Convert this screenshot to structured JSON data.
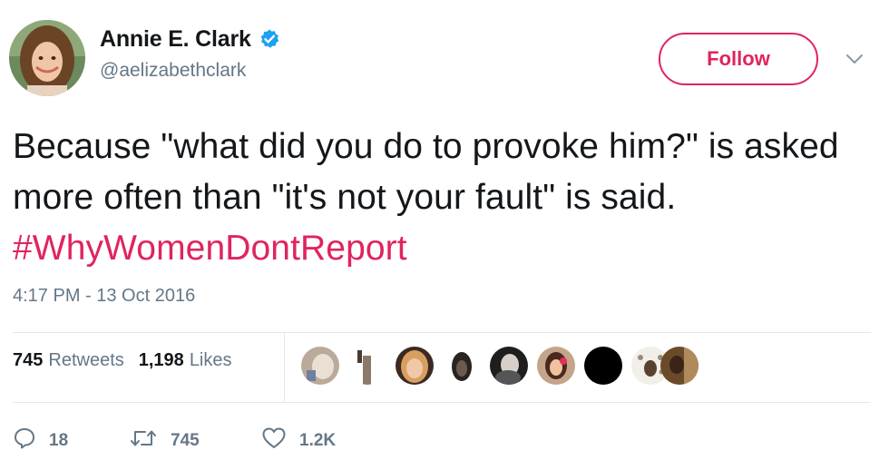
{
  "user": {
    "display_name": "Annie E. Clark",
    "handle": "@aelizabethclark",
    "avatar_icon": "profile-photo",
    "verified_icon": "verified-badge-icon"
  },
  "header": {
    "follow_label": "Follow",
    "menu_icon": "chevron-down-icon"
  },
  "tweet": {
    "text_before": "Because \"what did you do to provoke him?\" is asked more often than \"it's not your fault\" is said. ",
    "hashtag": "#WhyWomenDontReport",
    "timestamp": "4:17 PM - 13 Oct 2016"
  },
  "stats": {
    "retweets_count": "745",
    "retweets_label": "Retweets",
    "likes_count": "1,198",
    "likes_label": "Likes"
  },
  "actions": {
    "reply_count": "18",
    "retweet_count": "745",
    "like_count": "1.2K"
  },
  "colors": {
    "accent": "#e0245e",
    "verified": "#1da1f2",
    "muted": "#657786",
    "text": "#14171a"
  }
}
